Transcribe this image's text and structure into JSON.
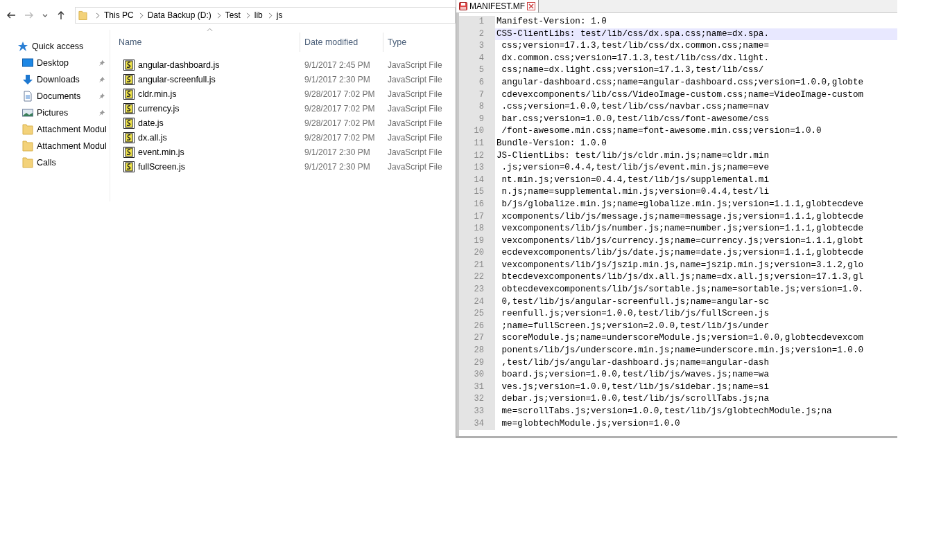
{
  "explorer": {
    "breadcrumb": [
      "This PC",
      "Data Backup (D:)",
      "Test",
      "lib",
      "js"
    ],
    "sidebar": [
      {
        "label": "Quick access",
        "kind": "quick",
        "pinned": false
      },
      {
        "label": "Desktop",
        "kind": "desktop",
        "pinned": true
      },
      {
        "label": "Downloads",
        "kind": "downloads",
        "pinned": true
      },
      {
        "label": "Documents",
        "kind": "documents",
        "pinned": true
      },
      {
        "label": "Pictures",
        "kind": "pictures",
        "pinned": true
      },
      {
        "label": "Attachment Modul",
        "kind": "folder",
        "pinned": false
      },
      {
        "label": "Attachment Modul",
        "kind": "folder",
        "pinned": false
      },
      {
        "label": "Calls",
        "kind": "folder",
        "pinned": false
      }
    ],
    "columns": [
      "Name",
      "Date modified",
      "Type"
    ],
    "rows": [
      {
        "name": "angular-dashboard.js",
        "date": "9/1/2017 2:45 PM",
        "type": "JavaScript File"
      },
      {
        "name": "angular-screenfull.js",
        "date": "9/1/2017 2:30 PM",
        "type": "JavaScript File"
      },
      {
        "name": "cldr.min.js",
        "date": "9/28/2017 7:02 PM",
        "type": "JavaScript File"
      },
      {
        "name": "currency.js",
        "date": "9/28/2017 7:02 PM",
        "type": "JavaScript File"
      },
      {
        "name": "date.js",
        "date": "9/28/2017 7:02 PM",
        "type": "JavaScript File"
      },
      {
        "name": "dx.all.js",
        "date": "9/28/2017 7:02 PM",
        "type": "JavaScript File"
      },
      {
        "name": "event.min.js",
        "date": "9/1/2017 2:30 PM",
        "type": "JavaScript File"
      },
      {
        "name": "fullScreen.js",
        "date": "9/1/2017 2:30 PM",
        "type": "JavaScript File"
      }
    ]
  },
  "editor": {
    "tab": {
      "title": "MANIFEST.MF",
      "selected": true
    },
    "lines": [
      {
        "number": "1",
        "text": "Manifest-Version: 1.0",
        "current": false
      },
      {
        "number": "2",
        "text": "CSS-ClientLibs: test/lib/css/dx.spa.css;name=dx.spa.",
        "current": true
      },
      {
        "number": "3",
        "text": " css;version=17.1.3,test/lib/css/dx.common.css;name=",
        "current": false
      },
      {
        "number": "4",
        "text": " dx.common.css;version=17.1.3,test/lib/css/dx.light.",
        "current": false
      },
      {
        "number": "5",
        "text": " css;name=dx.light.css;version=17.1.3,test/lib/css/",
        "current": false
      },
      {
        "number": "6",
        "text": " angular-dashboard.css;name=angular-dashboard.css;version=1.0.0,globte",
        "current": false
      },
      {
        "number": "7",
        "text": " cdevexcomponents/lib/css/VideoImage-custom.css;name=VideoImage-custom",
        "current": false
      },
      {
        "number": "8",
        "text": " .css;version=1.0.0,test/lib/css/navbar.css;name=nav",
        "current": false
      },
      {
        "number": "9",
        "text": " bar.css;version=1.0.0,test/lib/css/font-awesome/css",
        "current": false
      },
      {
        "number": "10",
        "text": " /font-awesome.min.css;name=font-awesome.min.css;version=1.0.0",
        "current": false
      },
      {
        "number": "11",
        "text": "Bundle-Version: 1.0.0",
        "current": false
      },
      {
        "number": "12",
        "text": "JS-ClientLibs: test/lib/js/cldr.min.js;name=cldr.min",
        "current": false
      },
      {
        "number": "13",
        "text": " .js;version=0.4.4,test/lib/js/event.min.js;name=eve",
        "current": false
      },
      {
        "number": "14",
        "text": " nt.min.js;version=0.4.4,test/lib/js/supplemental.mi",
        "current": false
      },
      {
        "number": "15",
        "text": " n.js;name=supplemental.min.js;version=0.4.4,test/li",
        "current": false
      },
      {
        "number": "16",
        "text": " b/js/globalize.min.js;name=globalize.min.js;version=1.1.1,globtecdeve",
        "current": false
      },
      {
        "number": "17",
        "text": " xcomponents/lib/js/message.js;name=message.js;version=1.1.1,globtecde",
        "current": false
      },
      {
        "number": "18",
        "text": " vexcomponents/lib/js/number.js;name=number.js;version=1.1.1,globtecde",
        "current": false
      },
      {
        "number": "19",
        "text": " vexcomponents/lib/js/currency.js;name=currency.js;version=1.1.1,globt",
        "current": false
      },
      {
        "number": "20",
        "text": " ecdevexcomponents/lib/js/date.js;name=date.js;version=1.1.1,globtecde",
        "current": false
      },
      {
        "number": "21",
        "text": " vexcomponents/lib/js/jszip.min.js,name=jszip.min.js;version=3.1.2,glo",
        "current": false
      },
      {
        "number": "22",
        "text": " btecdevexcomponents/lib/js/dx.all.js;name=dx.all.js;version=17.1.3,gl",
        "current": false
      },
      {
        "number": "23",
        "text": " obtecdevexcomponents/lib/js/sortable.js;name=sortable.js;version=1.0.",
        "current": false
      },
      {
        "number": "24",
        "text": " 0,test/lib/js/angular-screenfull.js;name=angular-sc",
        "current": false
      },
      {
        "number": "25",
        "text": " reenfull.js;version=1.0.0,test/lib/js/fullScreen.js",
        "current": false
      },
      {
        "number": "26",
        "text": " ;name=fullScreen.js;version=2.0.0,test/lib/js/under",
        "current": false
      },
      {
        "number": "27",
        "text": " scoreModule.js;name=underscoreModule.js;version=1.0.0,globtecdevexcom",
        "current": false
      },
      {
        "number": "28",
        "text": " ponents/lib/js/underscore.min.js;name=underscore.min.js;version=1.0.0",
        "current": false
      },
      {
        "number": "29",
        "text": " ,test/lib/js/angular-dashboard.js;name=angular-dash",
        "current": false
      },
      {
        "number": "30",
        "text": " board.js;version=1.0.0,test/lib/js/waves.js;name=wa",
        "current": false
      },
      {
        "number": "31",
        "text": " ves.js;version=1.0.0,test/lib/js/sidebar.js;name=si",
        "current": false
      },
      {
        "number": "32",
        "text": " debar.js;version=1.0.0,test/lib/js/scrollTabs.js;na",
        "current": false
      },
      {
        "number": "33",
        "text": " me=scrollTabs.js;version=1.0.0,test/lib/js/globtechModule.js;na",
        "current": false
      },
      {
        "number": "34",
        "text": " me=globtechModule.js;version=1.0.0",
        "current": false
      }
    ]
  }
}
